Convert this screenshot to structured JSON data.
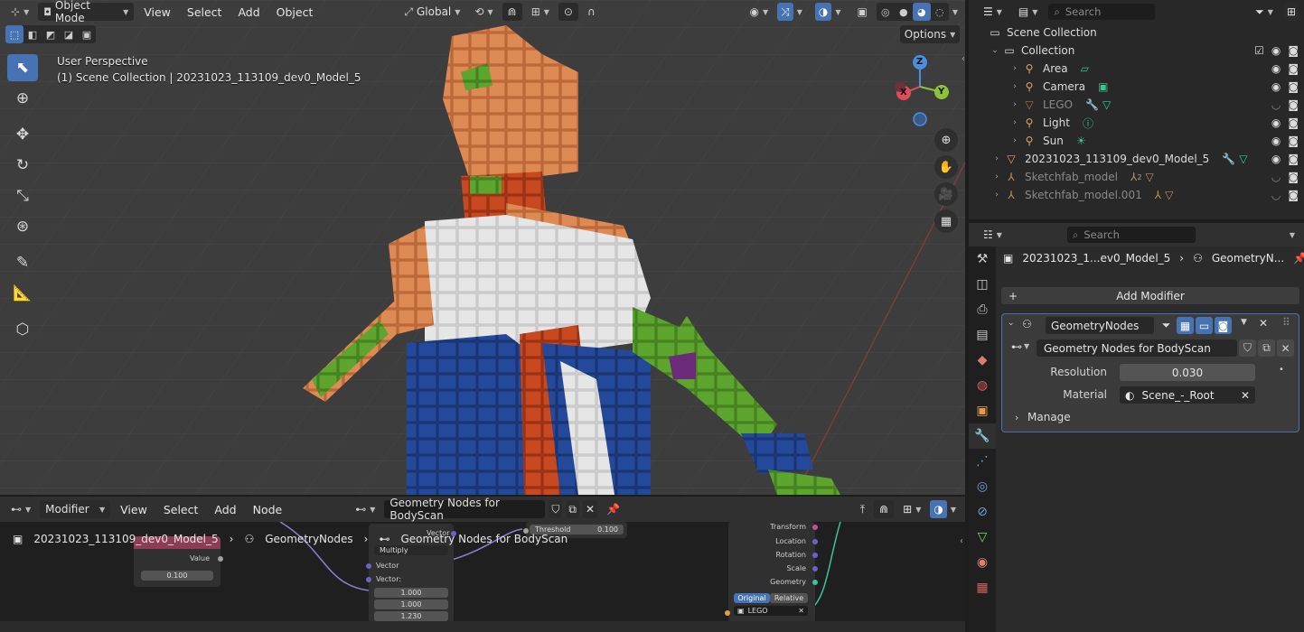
{
  "viewport": {
    "header": {
      "mode": "Object Mode",
      "menus": [
        "View",
        "Select",
        "Add",
        "Object"
      ],
      "orientation": "Global",
      "options_label": "Options"
    },
    "info": {
      "perspective": "User Perspective",
      "collection_line": "(1) Scene Collection | 20231023_113109_dev0_Model_5"
    },
    "gizmo": {
      "x": "X",
      "y": "Y",
      "z": "Z"
    },
    "colors": {
      "background": "#3d3d3d",
      "active_tool": "#4772b3"
    }
  },
  "node_editor": {
    "header": {
      "type": "Modifier",
      "menus": [
        "View",
        "Select",
        "Add",
        "Node"
      ],
      "node_group": "Geometry Nodes for BodyScan"
    },
    "breadcrumb": {
      "object": "20231023_113109_dev0_Model_5",
      "modifier": "GeometryNodes",
      "group": "Geometry Nodes for BodyScan"
    },
    "nodes": {
      "value_node": {
        "output_label": "Value",
        "value": "0.100"
      },
      "math_node": {
        "output_label": "Vector",
        "operation": "Multiply",
        "input_a": "Vector",
        "input_b": "Vector:",
        "x": "1.000",
        "y": "1.000",
        "z": "1.230"
      },
      "threshold": {
        "label": "Threshold",
        "value": "0.100"
      },
      "object_info": {
        "outputs": [
          "Transform",
          "Location",
          "Rotation",
          "Scale",
          "Geometry"
        ],
        "mode_original": "Original",
        "mode_relative": "Relative",
        "object": "LEGO"
      }
    }
  },
  "outliner": {
    "search_placeholder": "Search",
    "scene_collection": "Scene Collection",
    "collection": "Collection",
    "items": [
      {
        "label": "Area",
        "dim": false
      },
      {
        "label": "Camera",
        "dim": false
      },
      {
        "label": "LEGO",
        "dim": true
      },
      {
        "label": "Light",
        "dim": false
      },
      {
        "label": "Sun",
        "dim": false
      }
    ],
    "model": "20231023_113109_dev0_Model_5",
    "sketchfab_1": "Sketchfab_model",
    "sketchfab_1_count": "2",
    "sketchfab_2": "Sketchfab_model.001"
  },
  "properties": {
    "search_placeholder": "Search",
    "breadcrumb_object": "20231023_1...ev0_Model_5",
    "breadcrumb_modifier": "GeometryN...",
    "add_modifier": "Add Modifier",
    "modifier_name": "GeometryNodes",
    "node_group": "Geometry Nodes for BodyScan",
    "resolution_label": "Resolution",
    "resolution_value": "0.030",
    "material_label": "Material",
    "material_value": "Scene_-_Root",
    "manage_label": "Manage"
  }
}
